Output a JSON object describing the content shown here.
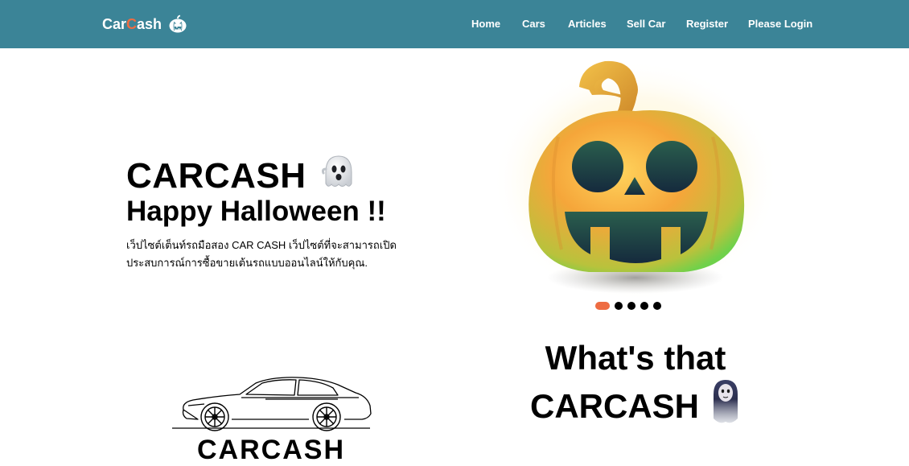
{
  "navbar": {
    "brand_pre": "Car",
    "brand_hl": "C",
    "brand_post": "ash",
    "brand_icon": "pumpkin-icon",
    "links": [
      {
        "label": "Home"
      },
      {
        "label": "Cars"
      },
      {
        "label": "Articles"
      },
      {
        "label": "Sell Car"
      },
      {
        "label": "Register"
      },
      {
        "label": "Please Login"
      }
    ]
  },
  "hero": {
    "title": "CARCASH",
    "title_icon": "ghost-icon",
    "subtitle": "Happy Halloween !!",
    "description": "เว็ปไซต์เต็นท์รถมือสอง CAR CASH เว็ปไซต์ที่จะสามารถเปิดประสบการณ์การซื้อขายเต้นรถแบบออนไลน์ให้กับคุณ.",
    "image_icon": "jack-o-lantern-icon",
    "carousel": {
      "total": 5,
      "active": 0
    }
  },
  "about": {
    "title_line1": "What's that",
    "title_line2": "CARCASH",
    "title_icon": "ghost-figure-icon",
    "car_icon": "car-sketch-icon",
    "car_caption": "CARCASH"
  },
  "colors": {
    "navbar_bg": "#3b8497",
    "accent": "#ee6c42"
  }
}
